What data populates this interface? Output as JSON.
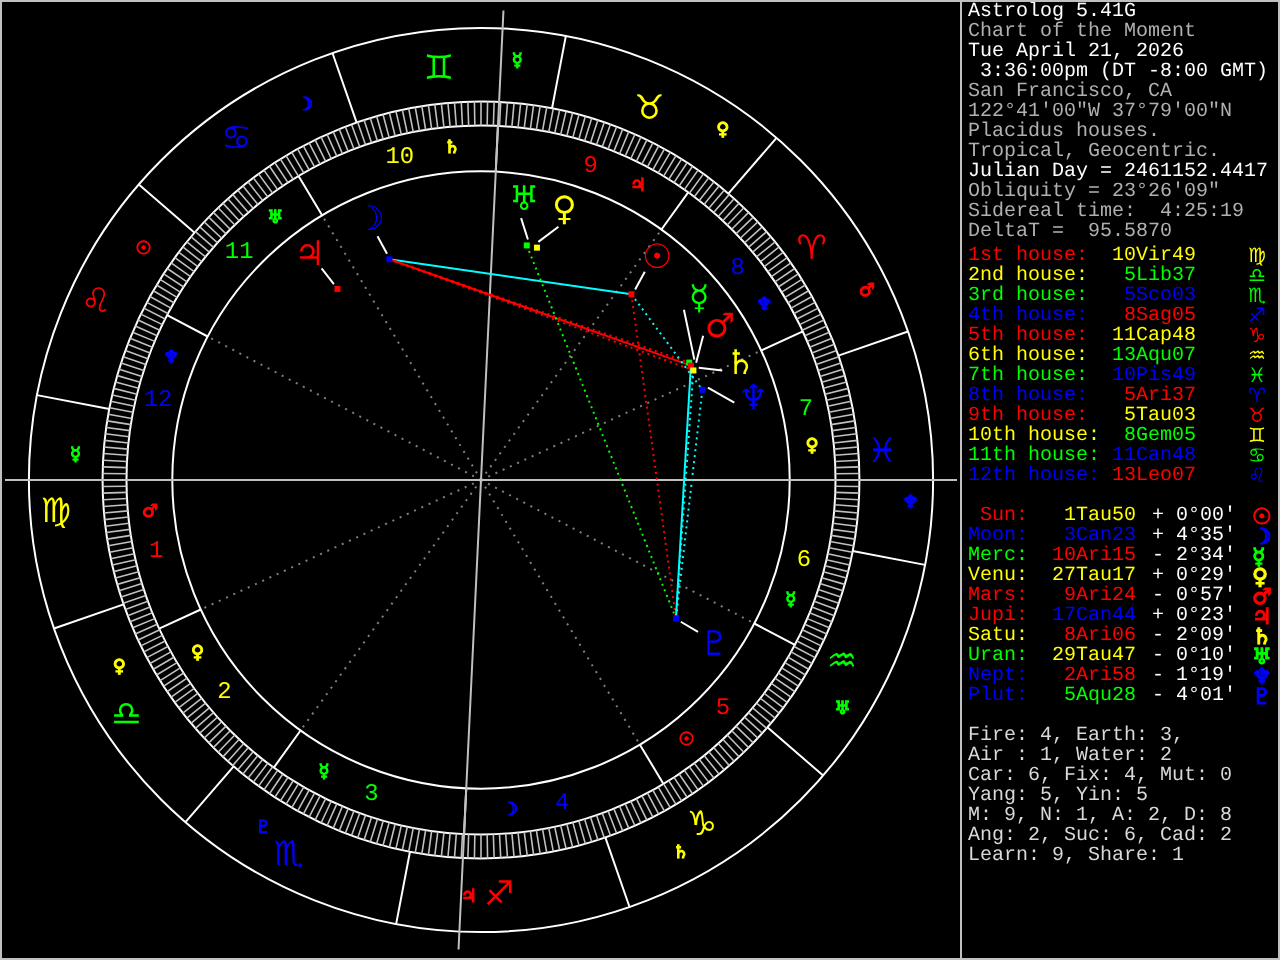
{
  "header": [
    {
      "text": "Astrolog 5.41G",
      "bright": true
    },
    {
      "text": "Chart of the Moment",
      "bright": false
    },
    {
      "text": "Tue April 21, 2026",
      "bright": true
    },
    {
      "text": " 3:36:00pm (DT -8:00 GMT)",
      "bright": true
    },
    {
      "text": "San Francisco, CA",
      "bright": false
    },
    {
      "text": "122°41'00\"W 37°79'00\"N",
      "bright": false
    },
    {
      "text": "Placidus houses.",
      "bright": false
    },
    {
      "text": "Tropical, Geocentric.",
      "bright": false
    },
    {
      "text": "Julian Day = 2461152.4417",
      "bright": true
    },
    {
      "text": "Obliquity = 23°26'09\"",
      "bright": false
    },
    {
      "text": "Sidereal time:  4:25:19",
      "bright": false
    },
    {
      "text": "DeltaT =  95.5870",
      "bright": false
    }
  ],
  "houses": [
    {
      "label": {
        "text": "1st house:",
        "color": "#ff0000"
      },
      "value": {
        "text": "10Vir49",
        "color": "#ffff00"
      },
      "glyph": {
        "text": "♍",
        "color": "#ffff00"
      }
    },
    {
      "label": {
        "text": "2nd house:",
        "color": "#ffff00"
      },
      "value": {
        "text": "5Lib37",
        "color": "#00ff00"
      },
      "glyph": {
        "text": "♎",
        "color": "#00ff00"
      }
    },
    {
      "label": {
        "text": "3rd house:",
        "color": "#00ff00"
      },
      "value": {
        "text": "5Sco03",
        "color": "#0000ff"
      },
      "glyph": {
        "text": "♏",
        "color": "#00ff00"
      }
    },
    {
      "label": {
        "text": "4th house:",
        "color": "#0000ff"
      },
      "value": {
        "text": "8Sag05",
        "color": "#ff0000"
      },
      "glyph": {
        "text": "♐",
        "color": "#0000ff"
      }
    },
    {
      "label": {
        "text": "5th house:",
        "color": "#ff0000"
      },
      "value": {
        "text": "11Cap48",
        "color": "#ffff00"
      },
      "glyph": {
        "text": "♑",
        "color": "#ff0000"
      }
    },
    {
      "label": {
        "text": "6th house:",
        "color": "#ffff00"
      },
      "value": {
        "text": "13Aqu07",
        "color": "#00ff00"
      },
      "glyph": {
        "text": "♒",
        "color": "#ffff00"
      }
    },
    {
      "label": {
        "text": "7th house:",
        "color": "#00ff00"
      },
      "value": {
        "text": "10Pis49",
        "color": "#0000ff"
      },
      "glyph": {
        "text": "♓",
        "color": "#00ff00"
      }
    },
    {
      "label": {
        "text": "8th house:",
        "color": "#0000ff"
      },
      "value": {
        "text": "5Ari37",
        "color": "#ff0000"
      },
      "glyph": {
        "text": "♈",
        "color": "#0000ff"
      }
    },
    {
      "label": {
        "text": "9th house:",
        "color": "#ff0000"
      },
      "value": {
        "text": "5Tau03",
        "color": "#ffff00"
      },
      "glyph": {
        "text": "♉",
        "color": "#ff0000"
      }
    },
    {
      "label": {
        "text": "10th house:",
        "color": "#ffff00"
      },
      "value": {
        "text": "8Gem05",
        "color": "#00ff00"
      },
      "glyph": {
        "text": "♊",
        "color": "#ffff00"
      }
    },
    {
      "label": {
        "text": "11th house:",
        "color": "#00ff00"
      },
      "value": {
        "text": "11Can48",
        "color": "#0000ff"
      },
      "glyph": {
        "text": "♋",
        "color": "#00ff00"
      }
    },
    {
      "label": {
        "text": "12th house:",
        "color": "#0000ff"
      },
      "value": {
        "text": "13Leo07",
        "color": "#ff0000"
      },
      "glyph": {
        "text": "♌",
        "color": "#0000ff"
      }
    }
  ],
  "planets": [
    {
      "label": {
        "text": "Sun:",
        "color": "#ff0000"
      },
      "position": {
        "text": "1Tau50",
        "color": "#ffff00"
      },
      "motion": "+ 0°00'",
      "glyph": {
        "text": "☉",
        "color": "#ff0000"
      }
    },
    {
      "label": {
        "text": "Moon:",
        "color": "#0000ff"
      },
      "position": {
        "text": "3Can23",
        "color": "#0000ff"
      },
      "motion": "+ 4°35'",
      "glyph": {
        "text": "☽",
        "color": "#0000ff"
      }
    },
    {
      "label": {
        "text": "Merc:",
        "color": "#00ff00"
      },
      "position": {
        "text": "10Ari15",
        "color": "#ff0000"
      },
      "motion": "- 2°34'",
      "glyph": {
        "text": "☿",
        "color": "#00ff00"
      }
    },
    {
      "label": {
        "text": "Venu:",
        "color": "#ffff00"
      },
      "position": {
        "text": "27Tau17",
        "color": "#ffff00"
      },
      "motion": "+ 0°29'",
      "glyph": {
        "text": "♀",
        "color": "#ffff00"
      }
    },
    {
      "label": {
        "text": "Mars:",
        "color": "#ff0000"
      },
      "position": {
        "text": "9Ari24",
        "color": "#ff0000"
      },
      "motion": "- 0°57'",
      "glyph": {
        "text": "♂",
        "color": "#ff0000"
      }
    },
    {
      "label": {
        "text": "Jupi:",
        "color": "#ff0000"
      },
      "position": {
        "text": "17Can44",
        "color": "#0000ff"
      },
      "motion": "+ 0°23'",
      "glyph": {
        "text": "♃",
        "color": "#ff0000"
      }
    },
    {
      "label": {
        "text": "Satu:",
        "color": "#ffff00"
      },
      "position": {
        "text": "8Ari06",
        "color": "#ff0000"
      },
      "motion": "- 2°09'",
      "glyph": {
        "text": "♄",
        "color": "#ffff00"
      }
    },
    {
      "label": {
        "text": "Uran:",
        "color": "#00ff00"
      },
      "position": {
        "text": "29Tau47",
        "color": "#ffff00"
      },
      "motion": "- 0°10'",
      "glyph": {
        "text": "♅",
        "color": "#00ff00"
      }
    },
    {
      "label": {
        "text": "Nept:",
        "color": "#0000ff"
      },
      "position": {
        "text": "2Ari58",
        "color": "#ff0000"
      },
      "motion": "- 1°19'",
      "glyph": {
        "text": "♆",
        "color": "#0000ff"
      }
    },
    {
      "label": {
        "text": "Plut:",
        "color": "#0000ff"
      },
      "position": {
        "text": "5Aqu28",
        "color": "#00ff00"
      },
      "motion": "- 4°01'",
      "glyph": {
        "text": "♇",
        "color": "#0000ff"
      }
    }
  ],
  "summary": [
    "Fire: 4, Earth: 3,",
    "Air : 1, Water: 2",
    "Car: 6, Fix: 4, Mut: 0",
    "Yang: 5, Yin: 5",
    "M: 9, N: 1, A: 2, D: 8",
    "Ang: 2, Suc: 6, Cad: 2",
    "Learn: 9, Share: 1"
  ],
  "wheel": {
    "signs": [
      {
        "glyph": {
          "text": "♈",
          "color": "#ff0000"
        },
        "ruler": {
          "text": "♂",
          "color": "#ff0000"
        }
      },
      {
        "glyph": {
          "text": "♉",
          "color": "#ffff00"
        },
        "ruler": {
          "text": "♀",
          "color": "#ffff00"
        }
      },
      {
        "glyph": {
          "text": "♊",
          "color": "#00ff00"
        },
        "ruler": {
          "text": "☿",
          "color": "#00ff00"
        }
      },
      {
        "glyph": {
          "text": "♋",
          "color": "#0000ff"
        },
        "ruler": {
          "text": "☽",
          "color": "#0000ff"
        }
      },
      {
        "glyph": {
          "text": "♌",
          "color": "#ff0000"
        },
        "ruler": {
          "text": "☉",
          "color": "#ff0000"
        }
      },
      {
        "glyph": {
          "text": "♍",
          "color": "#ffff00"
        },
        "ruler": {
          "text": "☿",
          "color": "#00ff00"
        }
      },
      {
        "glyph": {
          "text": "♎",
          "color": "#00ff00"
        },
        "ruler": {
          "text": "♀",
          "color": "#ffff00"
        }
      },
      {
        "glyph": {
          "text": "♏",
          "color": "#0000ff"
        },
        "ruler": {
          "text": "♇",
          "color": "#0000ff"
        }
      },
      {
        "glyph": {
          "text": "♐",
          "color": "#ff0000"
        },
        "ruler": {
          "text": "♃",
          "color": "#ff0000"
        }
      },
      {
        "glyph": {
          "text": "♑",
          "color": "#ffff00"
        },
        "ruler": {
          "text": "♄",
          "color": "#ffff00"
        }
      },
      {
        "glyph": {
          "text": "♒",
          "color": "#00ff00"
        },
        "ruler": {
          "text": "♅",
          "color": "#00ff00"
        }
      },
      {
        "glyph": {
          "text": "♓",
          "color": "#0000ff"
        },
        "ruler": {
          "text": "♆",
          "color": "#0000ff"
        }
      }
    ],
    "houses": [
      {
        "number": {
          "text": "1",
          "color": "#ff0000"
        },
        "ruler": {
          "text": "♂",
          "color": "#ff0000"
        }
      },
      {
        "number": {
          "text": "2",
          "color": "#ffff00"
        },
        "ruler": {
          "text": "♀",
          "color": "#ffff00"
        }
      },
      {
        "number": {
          "text": "3",
          "color": "#00ff00"
        },
        "ruler": {
          "text": "☿",
          "color": "#00ff00"
        }
      },
      {
        "number": {
          "text": "4",
          "color": "#0000ff"
        },
        "ruler": {
          "text": "☽",
          "color": "#0000ff"
        }
      },
      {
        "number": {
          "text": "5",
          "color": "#ff0000"
        },
        "ruler": {
          "text": "☉",
          "color": "#ff0000"
        }
      },
      {
        "number": {
          "text": "6",
          "color": "#ffff00"
        },
        "ruler": {
          "text": "☿",
          "color": "#00ff00"
        }
      },
      {
        "number": {
          "text": "7",
          "color": "#00ff00"
        },
        "ruler": {
          "text": "♀",
          "color": "#ffff00"
        }
      },
      {
        "number": {
          "text": "8",
          "color": "#0000ff"
        },
        "ruler": {
          "text": "♆",
          "color": "#0000ff"
        }
      },
      {
        "number": {
          "text": "9",
          "color": "#ff0000"
        },
        "ruler": {
          "text": "♃",
          "color": "#ff0000"
        }
      },
      {
        "number": {
          "text": "10",
          "color": "#ffff00"
        },
        "ruler": {
          "text": "♄",
          "color": "#ffff00"
        }
      },
      {
        "number": {
          "text": "11",
          "color": "#00ff00"
        },
        "ruler": {
          "text": "♅",
          "color": "#00ff00"
        }
      },
      {
        "number": {
          "text": "12",
          "color": "#0000ff"
        },
        "ruler": {
          "text": "♆",
          "color": "#0000ff"
        }
      }
    ],
    "planets": [
      {
        "text": "☉",
        "color": "#ff0000"
      },
      {
        "text": "☽",
        "color": "#0000ff"
      },
      {
        "text": "☿",
        "color": "#00ff00"
      },
      {
        "text": "♀",
        "color": "#ffff00"
      },
      {
        "text": "♂",
        "color": "#ff0000"
      },
      {
        "text": "♃",
        "color": "#ff0000"
      },
      {
        "text": "♄",
        "color": "#ffff00"
      },
      {
        "text": "♅",
        "color": "#00ff00"
      },
      {
        "text": "♆",
        "color": "#0000ff"
      },
      {
        "text": "♇",
        "color": "#0000ff"
      }
    ]
  }
}
